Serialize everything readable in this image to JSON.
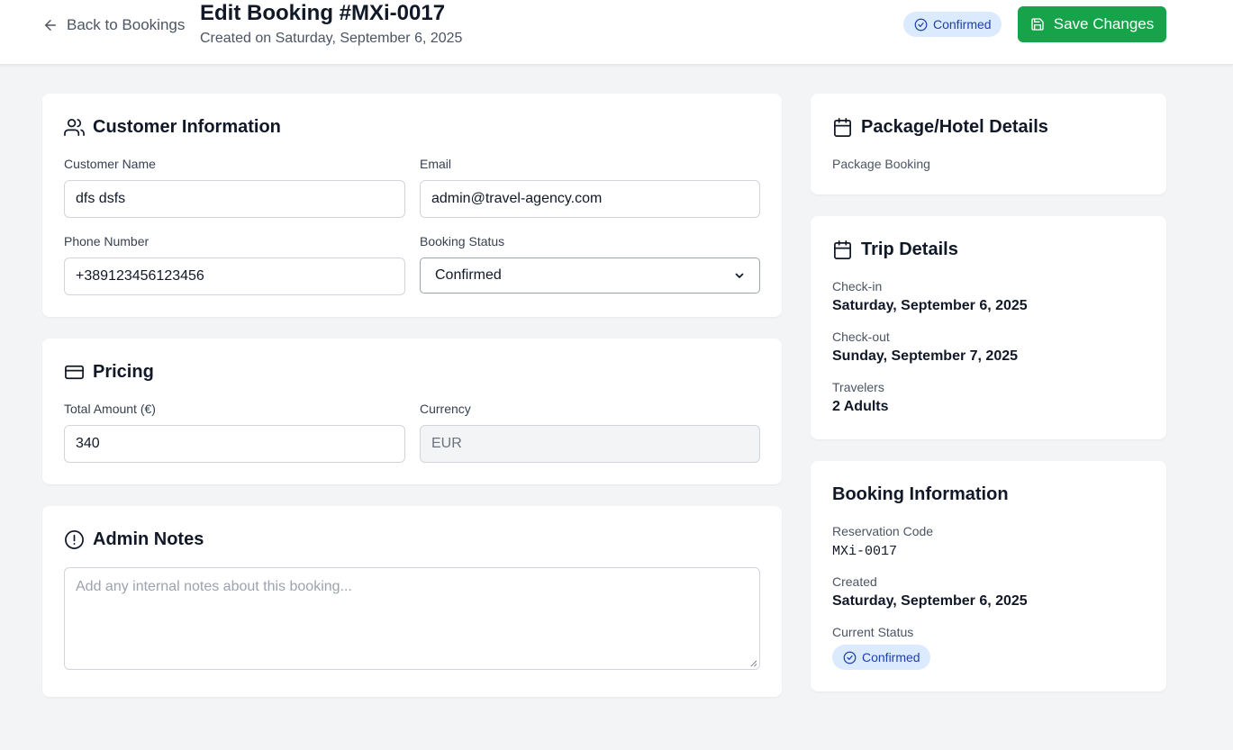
{
  "header": {
    "back_label": "Back to Bookings",
    "title": "Edit Booking #MXi-0017",
    "subtitle": "Created on Saturday, September 6, 2025",
    "status_badge": "Confirmed",
    "save_label": "Save Changes"
  },
  "customer": {
    "title": "Customer Information",
    "name_label": "Customer Name",
    "name_value": "dfs dsfs",
    "email_label": "Email",
    "email_value": "admin@travel-agency.com",
    "phone_label": "Phone Number",
    "phone_value": "+389123456123456",
    "status_label": "Booking Status",
    "status_value": "Confirmed"
  },
  "pricing": {
    "title": "Pricing",
    "amount_label": "Total Amount (€)",
    "amount_value": "340",
    "currency_label": "Currency",
    "currency_value": "EUR"
  },
  "notes": {
    "title": "Admin Notes",
    "placeholder": "Add any internal notes about this booking..."
  },
  "package": {
    "title": "Package/Hotel Details",
    "type": "Package Booking"
  },
  "trip": {
    "title": "Trip Details",
    "checkin_label": "Check-in",
    "checkin_value": "Saturday, September 6, 2025",
    "checkout_label": "Check-out",
    "checkout_value": "Sunday, September 7, 2025",
    "travelers_label": "Travelers",
    "travelers_value": "2 Adults"
  },
  "booking_info": {
    "title": "Booking Information",
    "code_label": "Reservation Code",
    "code_value": "MXi-0017",
    "created_label": "Created",
    "created_value": "Saturday, September 6, 2025",
    "status_label": "Current Status",
    "status_value": "Confirmed"
  },
  "colors": {
    "save_button": "#16a34a",
    "status_badge_bg": "#dbeafe",
    "status_badge_text": "#1e40af",
    "page_bg": "#f3f4f6"
  },
  "icons": {
    "back": "arrow-left-icon",
    "badge": "check-circle-icon",
    "save": "save-icon",
    "customer": "users-icon",
    "pricing": "credit-card-icon",
    "notes": "alert-circle-icon",
    "package": "calendar-icon",
    "trip": "calendar-icon",
    "select": "chevron-down-icon"
  }
}
